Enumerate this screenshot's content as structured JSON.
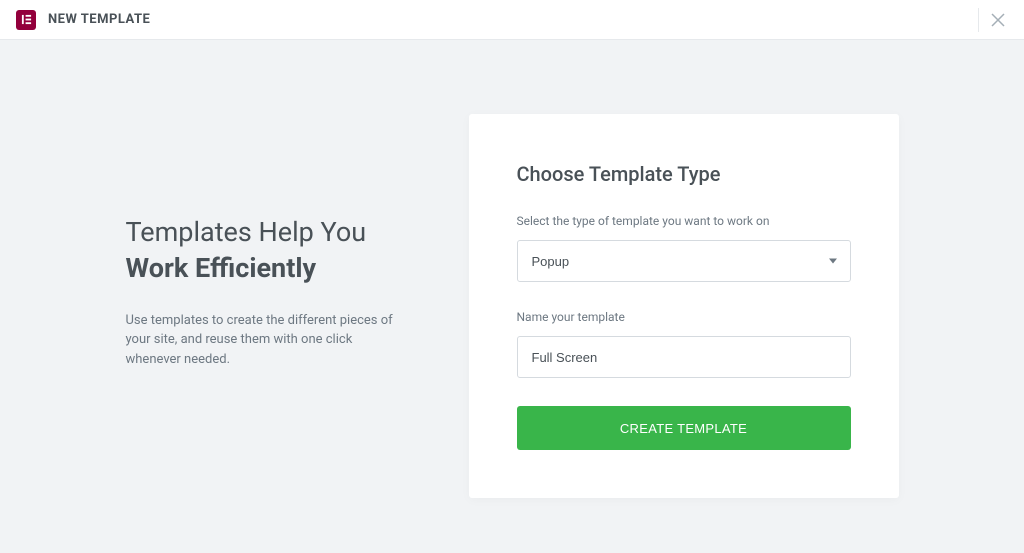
{
  "header": {
    "title": "NEW TEMPLATE"
  },
  "intro": {
    "headline_line1": "Templates Help You",
    "headline_line2": "Work Efficiently",
    "description": "Use templates to create the different pieces of your site, and reuse them with one click whenever needed."
  },
  "form": {
    "title": "Choose Template Type",
    "type_label": "Select the type of template you want to work on",
    "type_value": "Popup",
    "name_label": "Name your template",
    "name_value": "Full Screen",
    "submit_label": "CREATE TEMPLATE"
  }
}
